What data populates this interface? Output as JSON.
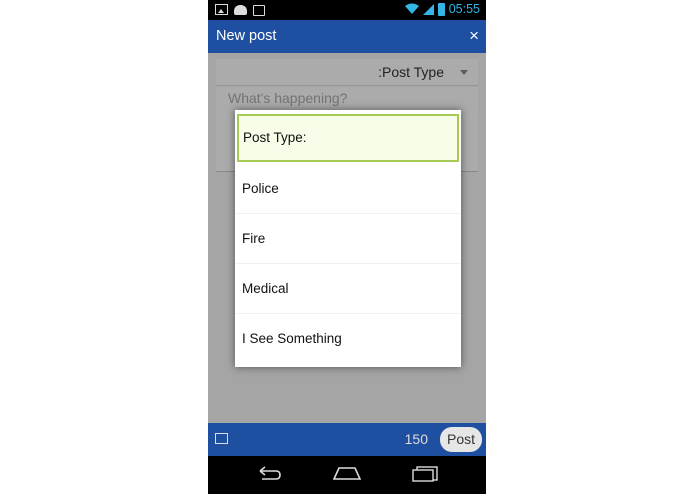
{
  "status_bar": {
    "time": "05:55",
    "icons": [
      "image-icon",
      "android-icon",
      "bag-icon"
    ]
  },
  "action_bar": {
    "title": "New post",
    "close_label": "×"
  },
  "form": {
    "post_type_spinner": ":Post Type",
    "message_placeholder": "What's happening?"
  },
  "dialog": {
    "options": [
      "Post Type:",
      "Police",
      "Fire",
      "Medical",
      "I See Something"
    ],
    "selected_index": 0
  },
  "bottom_bar": {
    "char_count": "150",
    "post_label": "Post"
  },
  "colors": {
    "primary": "#1e4fa0",
    "accent": "#33b5e5",
    "selected_bg": "#f7fde8",
    "selected_border": "#a6cc55"
  }
}
